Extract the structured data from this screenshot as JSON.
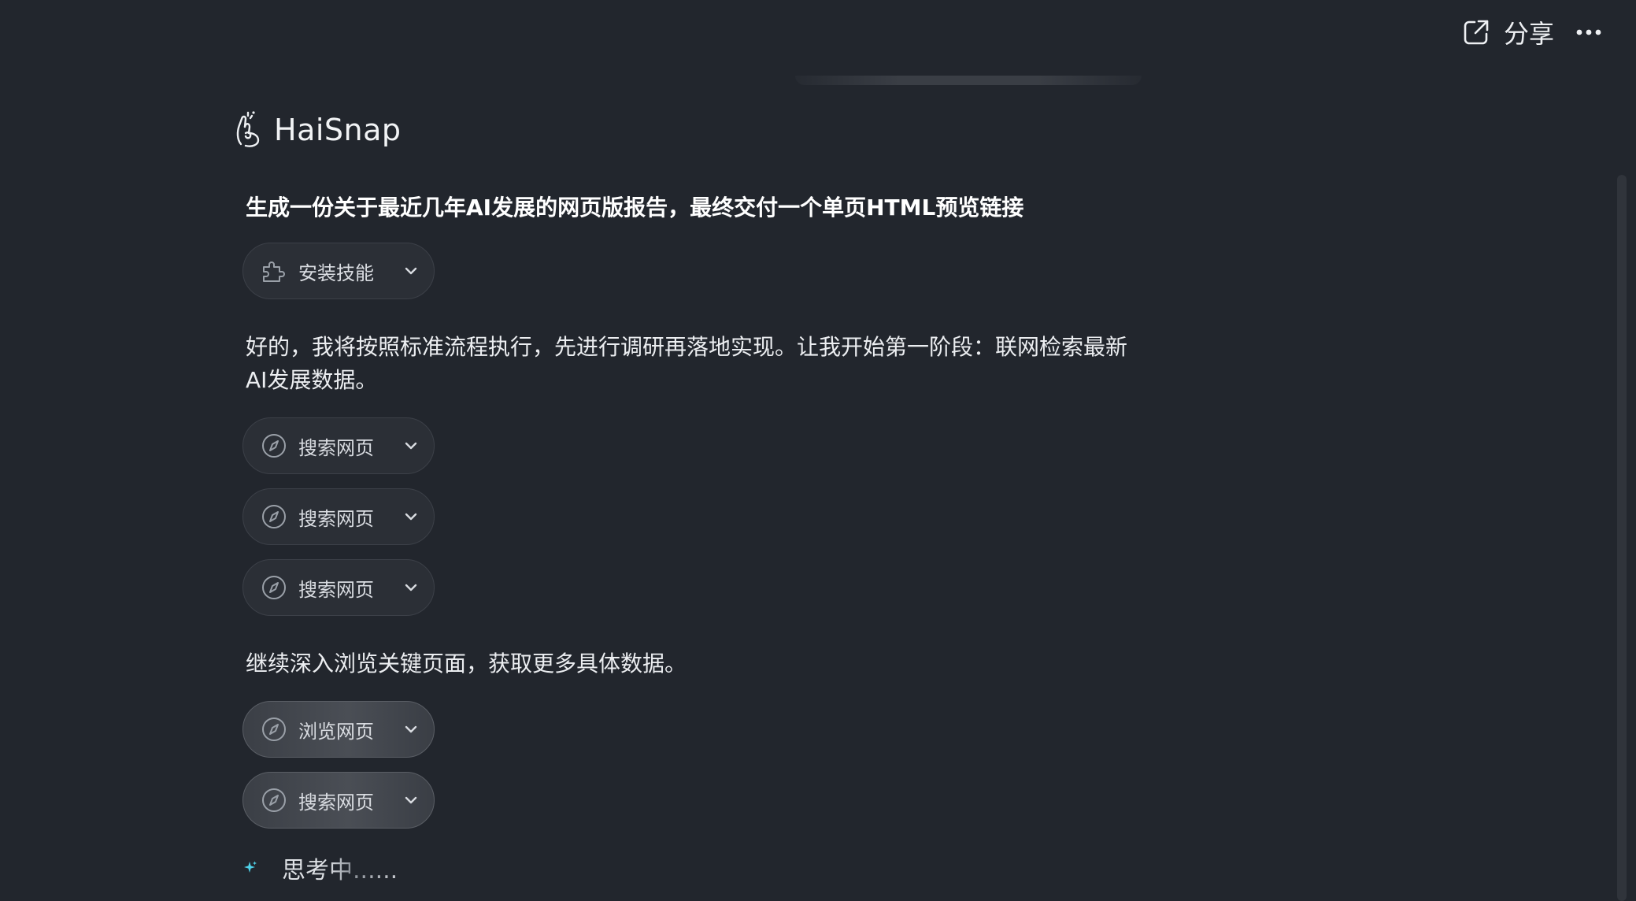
{
  "header": {
    "share_label": "分享",
    "share_icon": "share-external-icon",
    "more_icon": "more-horizontal-icon"
  },
  "brand": {
    "name": "HaiSnap",
    "logo_icon": "hand-snap-logo-icon"
  },
  "conversation": {
    "user_prompt": "生成一份关于最近几年AI发展的网页版报告，最终交付一个单页HTML预览链接",
    "steps": [
      {
        "type": "tool",
        "label": "安装技能",
        "icon": "puzzle-icon"
      },
      {
        "type": "text",
        "text": "好的，我将按照标准流程执行，先进行调研再落地实现。让我开始第一阶段：联网检索最新AI发展数据。"
      },
      {
        "type": "tool",
        "label": "搜索网页",
        "icon": "compass-icon"
      },
      {
        "type": "tool",
        "label": "搜索网页",
        "icon": "compass-icon"
      },
      {
        "type": "tool",
        "label": "搜索网页",
        "icon": "compass-icon"
      },
      {
        "type": "text",
        "text": "继续深入浏览关键页面，获取更多具体数据。"
      },
      {
        "type": "tool",
        "label": "浏览网页",
        "icon": "compass-icon"
      },
      {
        "type": "tool",
        "label": "搜索网页",
        "icon": "compass-icon"
      }
    ],
    "status_text": "思考中......",
    "status_icon": "sparkle-icon"
  },
  "colors": {
    "background": "#22262d",
    "chip_bg": "#2b2f36",
    "accent_sparkle": "#4fd1e8"
  }
}
